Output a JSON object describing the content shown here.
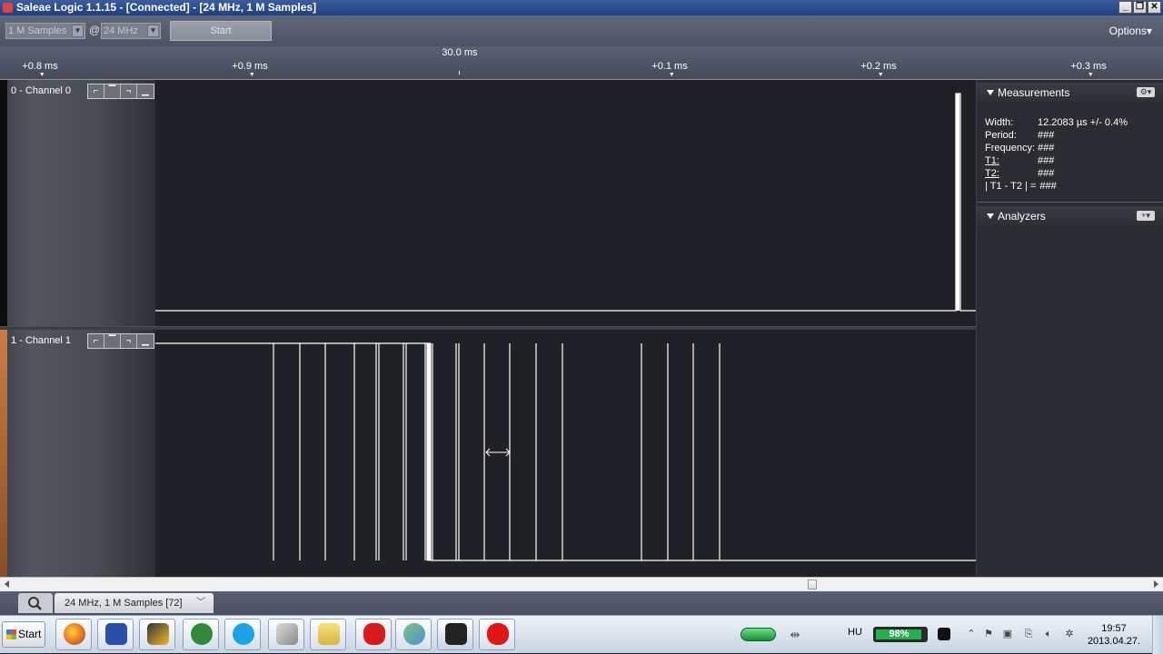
{
  "window": {
    "title": "Saleae Logic 1.1.15 - [Connected] - [24 MHz, 1 M Samples]",
    "buttons": [
      "_",
      "❐",
      "✕"
    ]
  },
  "toolbar": {
    "samples_value": "1 M Samples",
    "at_sign": "@",
    "rate_value": "24 MHz",
    "start_label": "Start",
    "options_label": "Options▾"
  },
  "ruler": {
    "center_time": "30.0 ms",
    "ticks": [
      "+0.8 ms",
      "+0.9 ms",
      "+0.1 ms",
      "+0.2 ms",
      "+0.3 ms"
    ]
  },
  "channels": [
    {
      "name": "0 - Channel 0"
    },
    {
      "name": "1 - Channel 1"
    }
  ],
  "trigger_icons": [
    "rising-edge-icon",
    "high-level-icon",
    "falling-edge-icon",
    "low-level-icon"
  ],
  "measurements": {
    "title": "Measurements",
    "rows": [
      {
        "key": "Width:",
        "value": "12.2083 µs +/- 0.4%"
      },
      {
        "key": "Period:",
        "value": "###"
      },
      {
        "key": "Frequency:",
        "value": "###"
      },
      {
        "key": "T1:",
        "value": "###"
      },
      {
        "key": "T2:",
        "value": "###"
      },
      {
        "key": "| T1 - T2 | =",
        "value": "###"
      }
    ]
  },
  "analyzers": {
    "title": "Analyzers"
  },
  "session_tab": {
    "label": "24 MHz, 1 M Samples [72]"
  },
  "taskbar": {
    "start_label": "Start",
    "lang": "HU",
    "battery_pct": "98%",
    "battery_level": 0.98,
    "time": "19:57",
    "date": "2013.04.27."
  }
}
